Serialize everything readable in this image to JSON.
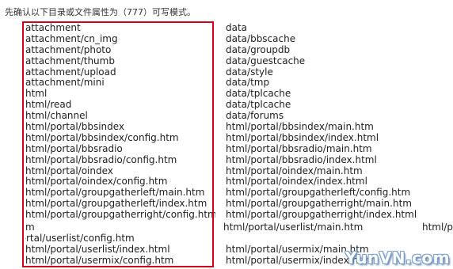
{
  "intro": "先确认以下目录或文件属性为（777）可写模式。",
  "left_paths": [
    "attachment",
    "attachment/cn_img",
    "attachment/photo",
    "attachment/thumb",
    "attachment/upload",
    "attachment/mini",
    "html",
    "html/read",
    "html/channel",
    "html/portal/bbsindex",
    "html/portal/bbsindex/config.htm",
    "html/portal/bbsradio",
    "html/portal/bbsradio/config.htm",
    "html/portal/oindex",
    "html/portal/oindex/config.htm",
    "html/portal/groupgatherleft/main.htm",
    "html/portal/groupgatherleft/index.htm",
    "html/portal/groupgatherright/config.htm"
  ],
  "right_paths": [
    "data",
    "data/bbscache",
    "data/groupdb",
    "data/guestcache",
    "data/style",
    "data/tmp",
    "data/tplcache",
    "data/tplcache",
    "data/forums",
    "html/portal/bbsindex/main.htm",
    "html/portal/bbsindex/index.html",
    "html/portal/bbsradio/main.htm",
    "html/portal/bbsradio/index.html",
    "html/portal/oindex/main.htm",
    "html/portal/oindex/index.html",
    "html/portal/groupgatherleft/config.htm",
    "html/portal/groupgatherright/main.htm",
    "html/portal/groupgatherright/index.html"
  ],
  "wrapped": {
    "m_fragment": "m",
    "rtal_fragment": "rtal/userlist/config.htm",
    "userlist_main": "html/portal/userlist/main.htm",
    "tail_fragment": "html/p",
    "userlist_index": "html/portal/userlist/index.html",
    "usermix_main": "html/portal/usermix/main.htm",
    "usermix_config": "html/portal/usermix/config.htm",
    "usermix_index": "html/portal/usermix/index.htm"
  },
  "watermark": "YunVN.com",
  "colors": {
    "highlight": "#d0021b",
    "text": "#1e1e1e"
  }
}
